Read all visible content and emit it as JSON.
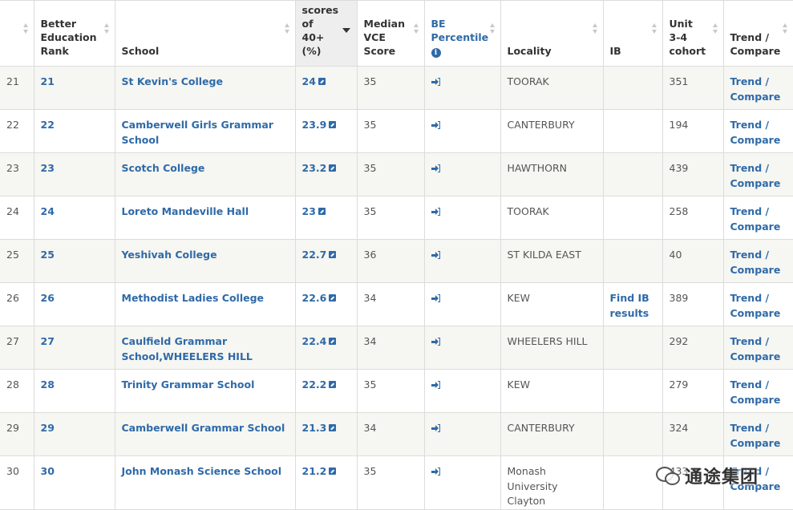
{
  "columns": {
    "row": "",
    "rank": "Better Education Rank",
    "school": "School",
    "scores": "scores of 40+ (%)",
    "median": "Median VCE Score",
    "be": "BE Percentile",
    "locality": "Locality",
    "ib": "IB",
    "cohort": "Unit 3-4 cohort",
    "trend": "Trend / Compare"
  },
  "rows": [
    {
      "row": "21",
      "rank": "21",
      "school": "St Kevin's College",
      "scores": "24",
      "median": "35",
      "locality": "TOORAK",
      "ib": "",
      "cohort": "351",
      "trend": "Trend / Compare"
    },
    {
      "row": "22",
      "rank": "22",
      "school": "Camberwell Girls Grammar School",
      "scores": "23.9",
      "median": "35",
      "locality": "CANTERBURY",
      "ib": "",
      "cohort": "194",
      "trend": "Trend / Compare"
    },
    {
      "row": "23",
      "rank": "23",
      "school": "Scotch College",
      "scores": "23.2",
      "median": "35",
      "locality": "HAWTHORN",
      "ib": "",
      "cohort": "439",
      "trend": "Trend / Compare"
    },
    {
      "row": "24",
      "rank": "24",
      "school": "Loreto Mandeville Hall",
      "scores": "23",
      "median": "35",
      "locality": "TOORAK",
      "ib": "",
      "cohort": "258",
      "trend": "Trend / Compare"
    },
    {
      "row": "25",
      "rank": "25",
      "school": "Yeshivah College",
      "scores": "22.7",
      "median": "36",
      "locality": "ST KILDA EAST",
      "ib": "",
      "cohort": "40",
      "trend": "Trend / Compare"
    },
    {
      "row": "26",
      "rank": "26",
      "school": "Methodist Ladies College",
      "scores": "22.6",
      "median": "34",
      "locality": "KEW",
      "ib": "Find IB results",
      "cohort": "389",
      "trend": "Trend / Compare"
    },
    {
      "row": "27",
      "rank": "27",
      "school": "Caulfield Grammar School,WHEELERS HILL",
      "scores": "22.4",
      "median": "34",
      "locality": "WHEELERS HILL",
      "ib": "",
      "cohort": "292",
      "trend": "Trend / Compare"
    },
    {
      "row": "28",
      "rank": "28",
      "school": "Trinity Grammar School",
      "scores": "22.2",
      "median": "35",
      "locality": "KEW",
      "ib": "",
      "cohort": "279",
      "trend": "Trend / Compare"
    },
    {
      "row": "29",
      "rank": "29",
      "school": "Camberwell Grammar School",
      "scores": "21.3",
      "median": "34",
      "locality": "CANTERBURY",
      "ib": "",
      "cohort": "324",
      "trend": "Trend / Compare"
    },
    {
      "row": "30",
      "rank": "30",
      "school": "John Monash Science School",
      "scores": "21.2",
      "median": "35",
      "locality": "Monash University Clayton",
      "ib": "",
      "cohort": "433",
      "trend": "Trend / Compare"
    }
  ],
  "icons": {
    "sort": "sort-icon",
    "sort_desc": "sort-desc-icon",
    "info": "info-icon",
    "external": "external-link-icon",
    "signin": "sign-in-icon"
  },
  "colors": {
    "link": "#2f6aa8",
    "row_alt": "#f6f6f2",
    "sorted_header": "#eeeeee"
  },
  "watermark": {
    "text": "通途集团"
  }
}
